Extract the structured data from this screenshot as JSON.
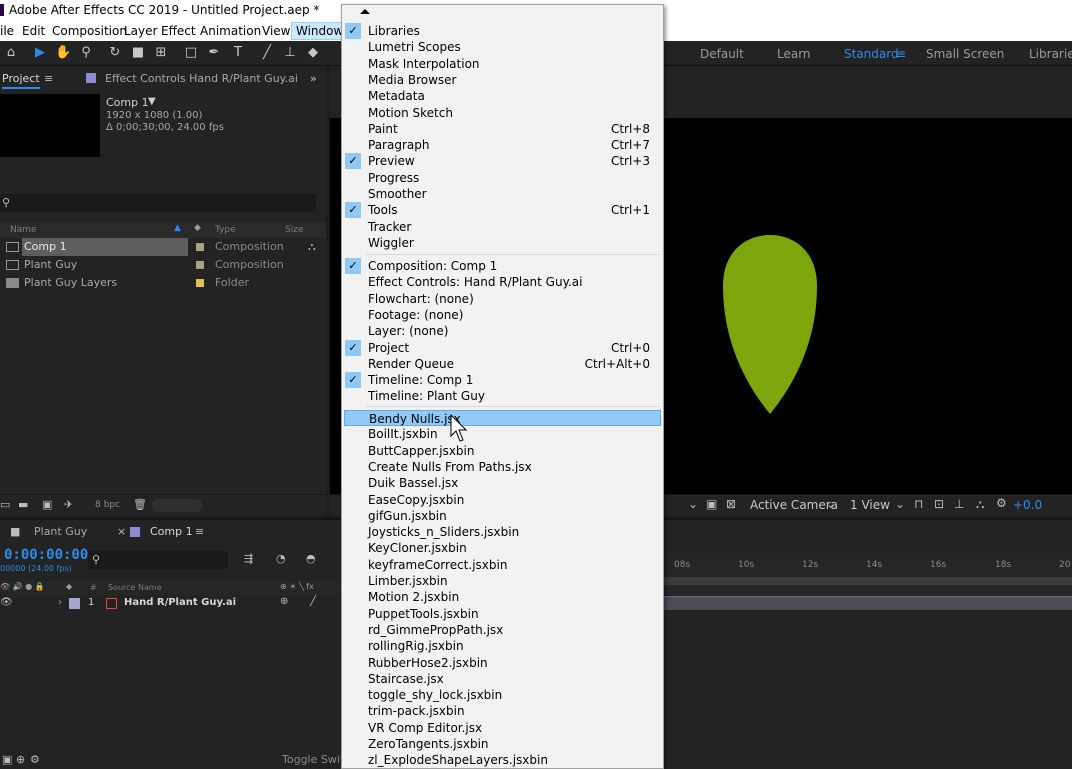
{
  "window": {
    "title": "Adobe After Effects CC 2019 - Untitled Project.aep *"
  },
  "menubar": {
    "items": [
      "ile",
      "Edit",
      "Composition",
      "Layer",
      "Effect",
      "Animation",
      "View",
      "Window"
    ],
    "active": "Window"
  },
  "workspaces": {
    "items": [
      "Default",
      "Learn",
      "Standard",
      "Small Screen",
      "Libraries"
    ],
    "active": "Standard"
  },
  "project_panel": {
    "tab_project": "Project",
    "tab_effect_controls": "Effect Controls Hand R/Plant Guy.ai",
    "comp_name": "Comp 1",
    "comp_size": "1920 x 1080 (1.00)",
    "comp_duration": "Δ 0;00;30;00, 24.00 fps",
    "columns": {
      "name": "Name",
      "type": "Type",
      "size": "Size"
    },
    "rows": [
      {
        "name": "Comp 1",
        "type": "Composition",
        "label_color": "#a7a085"
      },
      {
        "name": "Plant Guy",
        "type": "Composition",
        "label_color": "#a7a085"
      },
      {
        "name": "Plant Guy Layers",
        "type": "Folder",
        "label_color": "#e2c24d"
      }
    ],
    "bpc": "8 bpc"
  },
  "viewer": {
    "camera": "Active Camera",
    "view": "1 View",
    "exposure": "+0.0",
    "leaf_color": "#7fa50c"
  },
  "timeline": {
    "tab_plant_guy": "Plant Guy",
    "tab_comp": "Comp 1",
    "timecode": "0:00:00:00",
    "timecode_sub": "00000 (24.00 fps)",
    "header_source_name": "Source Name",
    "layer_number": "1",
    "layer_name": "Hand R/Plant Guy.ai",
    "ruler_ticks": [
      "08s",
      "10s",
      "12s",
      "14s",
      "16s",
      "18s",
      "20"
    ],
    "footer_toggle": "Toggle Switch"
  },
  "window_menu": {
    "groups": [
      [
        {
          "label": "Libraries",
          "checked": true,
          "shortcut": ""
        },
        {
          "label": "Lumetri Scopes",
          "checked": false,
          "shortcut": ""
        },
        {
          "label": "Mask Interpolation",
          "checked": false,
          "shortcut": ""
        },
        {
          "label": "Media Browser",
          "checked": false,
          "shortcut": ""
        },
        {
          "label": "Metadata",
          "checked": false,
          "shortcut": ""
        },
        {
          "label": "Motion Sketch",
          "checked": false,
          "shortcut": ""
        },
        {
          "label": "Paint",
          "checked": false,
          "shortcut": "Ctrl+8"
        },
        {
          "label": "Paragraph",
          "checked": false,
          "shortcut": "Ctrl+7"
        },
        {
          "label": "Preview",
          "checked": true,
          "shortcut": "Ctrl+3"
        },
        {
          "label": "Progress",
          "checked": false,
          "shortcut": ""
        },
        {
          "label": "Smoother",
          "checked": false,
          "shortcut": ""
        },
        {
          "label": "Tools",
          "checked": true,
          "shortcut": "Ctrl+1"
        },
        {
          "label": "Tracker",
          "checked": false,
          "shortcut": ""
        },
        {
          "label": "Wiggler",
          "checked": false,
          "shortcut": ""
        }
      ],
      [
        {
          "label": "Composition: Comp 1",
          "checked": true,
          "shortcut": ""
        },
        {
          "label": "Effect Controls: Hand R/Plant Guy.ai",
          "checked": false,
          "shortcut": ""
        },
        {
          "label": "Flowchart: (none)",
          "checked": false,
          "shortcut": ""
        },
        {
          "label": "Footage: (none)",
          "checked": false,
          "shortcut": ""
        },
        {
          "label": "Layer: (none)",
          "checked": false,
          "shortcut": ""
        },
        {
          "label": "Project",
          "checked": true,
          "shortcut": "Ctrl+0"
        },
        {
          "label": "Render Queue",
          "checked": false,
          "shortcut": "Ctrl+Alt+0"
        },
        {
          "label": "Timeline: Comp 1",
          "checked": true,
          "shortcut": ""
        },
        {
          "label": "Timeline: Plant Guy",
          "checked": false,
          "shortcut": ""
        }
      ],
      [
        {
          "label": "Bendy Nulls.jsx",
          "checked": false,
          "shortcut": "",
          "highlighted": true
        },
        {
          "label": "BoilIt.jsxbin",
          "checked": false,
          "shortcut": ""
        },
        {
          "label": "ButtCapper.jsxbin",
          "checked": false,
          "shortcut": ""
        },
        {
          "label": "Create Nulls From Paths.jsx",
          "checked": false,
          "shortcut": ""
        },
        {
          "label": "Duik Bassel.jsx",
          "checked": false,
          "shortcut": ""
        },
        {
          "label": "EaseCopy.jsxbin",
          "checked": false,
          "shortcut": ""
        },
        {
          "label": "gifGun.jsxbin",
          "checked": false,
          "shortcut": ""
        },
        {
          "label": "Joysticks_n_Sliders.jsxbin",
          "checked": false,
          "shortcut": ""
        },
        {
          "label": "KeyCloner.jsxbin",
          "checked": false,
          "shortcut": ""
        },
        {
          "label": "keyframeCorrect.jsxbin",
          "checked": false,
          "shortcut": ""
        },
        {
          "label": "Limber.jsxbin",
          "checked": false,
          "shortcut": ""
        },
        {
          "label": "Motion 2.jsxbin",
          "checked": false,
          "shortcut": ""
        },
        {
          "label": "PuppetTools.jsxbin",
          "checked": false,
          "shortcut": ""
        },
        {
          "label": "rd_GimmePropPath.jsx",
          "checked": false,
          "shortcut": ""
        },
        {
          "label": "rollingRig.jsxbin",
          "checked": false,
          "shortcut": ""
        },
        {
          "label": "RubberHose2.jsxbin",
          "checked": false,
          "shortcut": ""
        },
        {
          "label": "Staircase.jsx",
          "checked": false,
          "shortcut": ""
        },
        {
          "label": "toggle_shy_lock.jsxbin",
          "checked": false,
          "shortcut": ""
        },
        {
          "label": "trim-pack.jsxbin",
          "checked": false,
          "shortcut": ""
        },
        {
          "label": "VR Comp Editor.jsx",
          "checked": false,
          "shortcut": ""
        },
        {
          "label": "ZeroTangents.jsxbin",
          "checked": false,
          "shortcut": ""
        },
        {
          "label": "zl_ExplodeShapeLayers.jsxbin",
          "checked": false,
          "shortcut": ""
        }
      ]
    ]
  }
}
